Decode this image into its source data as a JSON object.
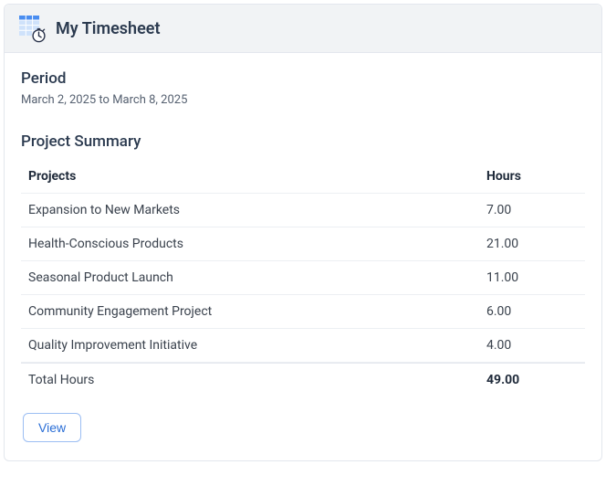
{
  "header": {
    "title": "My Timesheet"
  },
  "period": {
    "label": "Period",
    "range": "March 2, 2025 to March 8, 2025"
  },
  "summary": {
    "title": "Project Summary",
    "columns": {
      "project": "Projects",
      "hours": "Hours"
    },
    "rows": [
      {
        "project": "Expansion to New Markets",
        "hours": "7.00"
      },
      {
        "project": "Health-Conscious Products",
        "hours": "21.00"
      },
      {
        "project": "Seasonal Product Launch",
        "hours": "11.00"
      },
      {
        "project": "Community Engagement Project",
        "hours": "6.00"
      },
      {
        "project": "Quality Improvement Initiative",
        "hours": "4.00"
      }
    ],
    "total": {
      "label": "Total Hours",
      "hours": "49.00"
    }
  },
  "actions": {
    "view_label": "View"
  }
}
